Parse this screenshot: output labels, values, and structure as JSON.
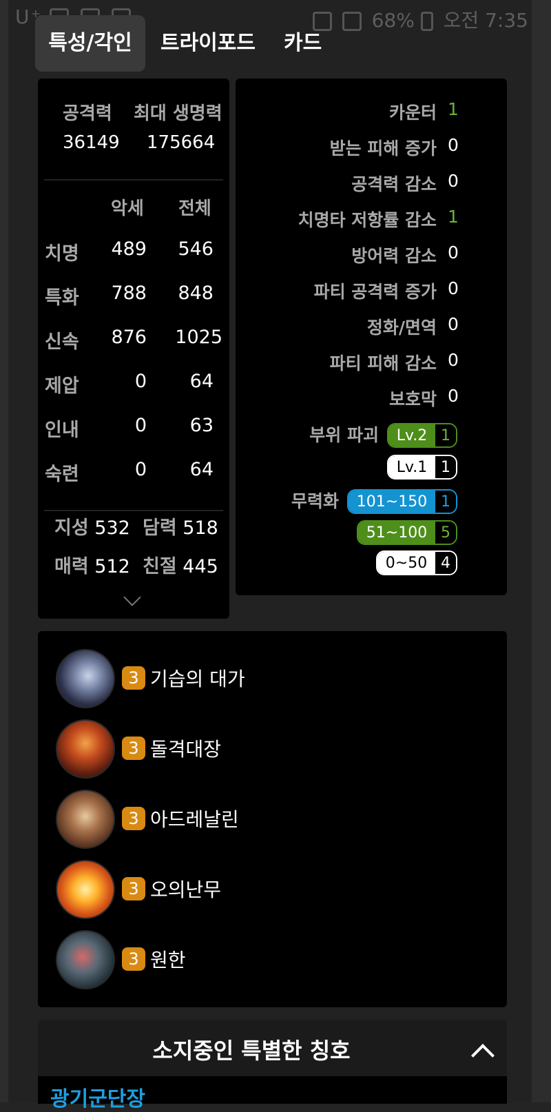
{
  "status_bar": {
    "left_icons": "U⁺",
    "battery": "68%",
    "time": "오전 7:35"
  },
  "tabs": [
    {
      "label": "특성/각인",
      "active": true
    },
    {
      "label": "트라이포드",
      "active": false
    },
    {
      "label": "카드",
      "active": false
    }
  ],
  "stats": {
    "attack_label": "공격력",
    "attack_value": "36149",
    "hp_label": "최대 생명력",
    "hp_value": "175664",
    "col_gear": "악세",
    "col_total": "전체",
    "rows": [
      {
        "label": "치명",
        "gear": "489",
        "total": "546"
      },
      {
        "label": "특화",
        "gear": "788",
        "total": "848"
      },
      {
        "label": "신속",
        "gear": "876",
        "total": "1025"
      },
      {
        "label": "제압",
        "gear": "0",
        "total": "64"
      },
      {
        "label": "인내",
        "gear": "0",
        "total": "63"
      },
      {
        "label": "숙련",
        "gear": "0",
        "total": "64"
      }
    ],
    "attributes": [
      {
        "label": "지성",
        "value": "532"
      },
      {
        "label": "담력",
        "value": "518"
      },
      {
        "label": "매력",
        "value": "512"
      },
      {
        "label": "친절",
        "value": "445"
      }
    ]
  },
  "debuffs": {
    "rows": [
      {
        "label": "카운터",
        "value": "1",
        "highlight": true
      },
      {
        "label": "받는 피해 증가",
        "value": "0",
        "highlight": false
      },
      {
        "label": "공격력 감소",
        "value": "0",
        "highlight": false
      },
      {
        "label": "치명타 저항률 감소",
        "value": "1",
        "highlight": true
      },
      {
        "label": "방어력 감소",
        "value": "0",
        "highlight": false
      },
      {
        "label": "파티 공격력 증가",
        "value": "0",
        "highlight": false
      },
      {
        "label": "정화/면역",
        "value": "0",
        "highlight": false
      },
      {
        "label": "파티 피해 감소",
        "value": "0",
        "highlight": false
      },
      {
        "label": "보호막",
        "value": "0",
        "highlight": false
      }
    ],
    "part_break_label": "부위 파괴",
    "part_break": [
      {
        "level": "Lv.2",
        "count": "1",
        "color": "green"
      },
      {
        "level": "Lv.1",
        "count": "1",
        "color": "white"
      }
    ],
    "stagger_label": "무력화",
    "stagger": [
      {
        "range": "101~150",
        "count": "1",
        "color": "blue"
      },
      {
        "range": "51~100",
        "count": "5",
        "color": "green"
      },
      {
        "range": "0~50",
        "count": "4",
        "color": "white"
      }
    ]
  },
  "engravings": [
    {
      "level": "3",
      "name": "기습의 대가",
      "icon": "ambush-master-icon"
    },
    {
      "level": "3",
      "name": "돌격대장",
      "icon": "raid-captain-icon"
    },
    {
      "level": "3",
      "name": "아드레날린",
      "icon": "adrenaline-icon"
    },
    {
      "level": "3",
      "name": "오의난무",
      "icon": "esoteric-flurry-icon"
    },
    {
      "level": "3",
      "name": "원한",
      "icon": "grudge-icon"
    }
  ],
  "special_titles": {
    "header": "소지중인 특별한 칭호",
    "first": "광기군단장"
  },
  "colors": {
    "green": "#4e8f1b",
    "blue": "#1493d1",
    "badge_orange": "#d88a12"
  }
}
